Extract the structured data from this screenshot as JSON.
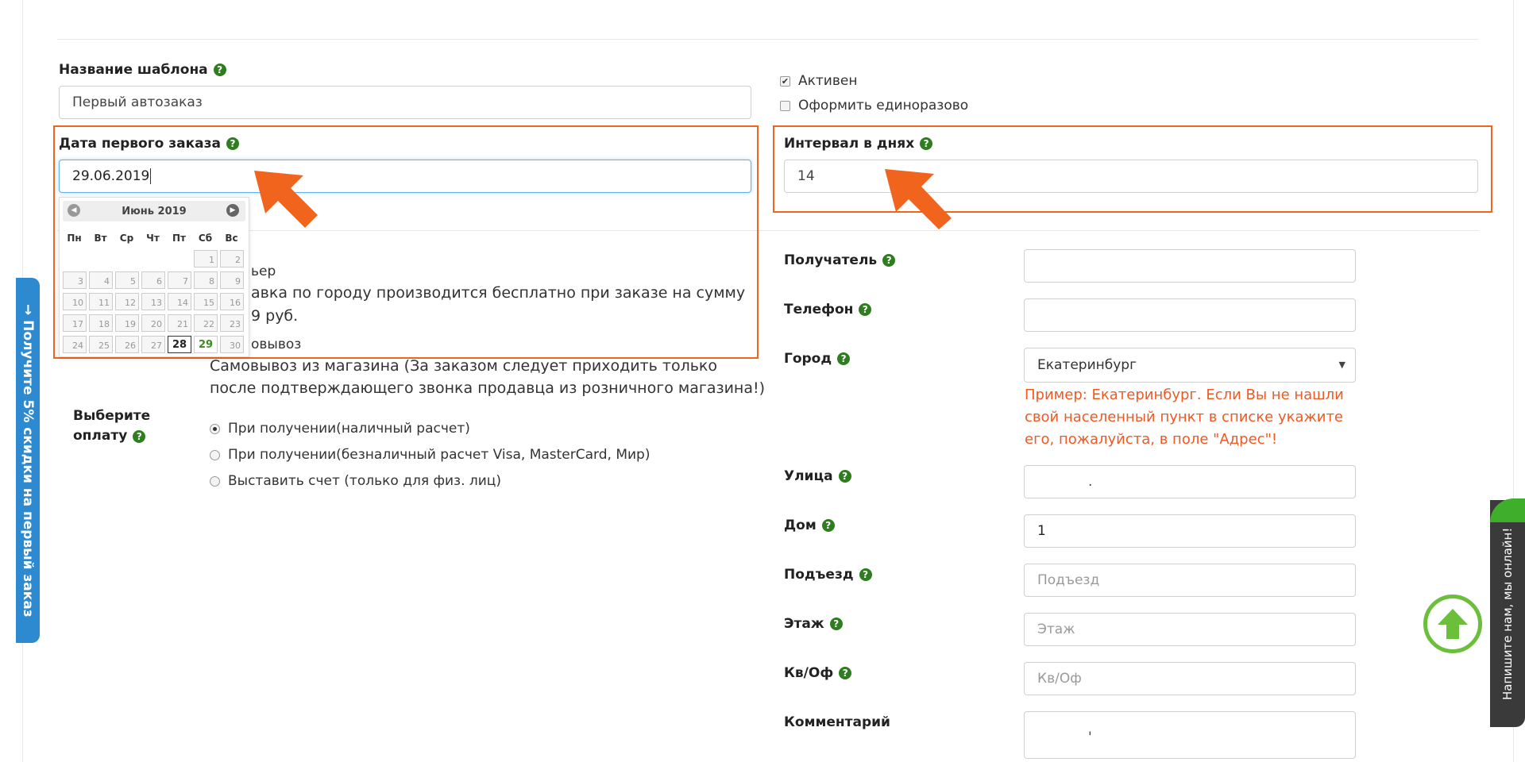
{
  "template": {
    "label": "Название шаблона",
    "value": "Первый автозаказ"
  },
  "active": {
    "label": "Активен",
    "checked": true
  },
  "once": {
    "label": "Оформить единоразово",
    "checked": false
  },
  "first_date": {
    "label": "Дата первого заказа",
    "value": "29.06.2019"
  },
  "interval": {
    "label": "Интервал в днях",
    "value": "14"
  },
  "calendar": {
    "month": "Июнь 2019",
    "weekdays": [
      "Пн",
      "Вт",
      "Ср",
      "Чт",
      "Пт",
      "Сб",
      "Вс"
    ],
    "weeks": [
      [
        "",
        "",
        "",
        "",
        "",
        "1",
        "2"
      ],
      [
        "3",
        "4",
        "5",
        "6",
        "7",
        "8",
        "9"
      ],
      [
        "10",
        "11",
        "12",
        "13",
        "14",
        "15",
        "16"
      ],
      [
        "17",
        "18",
        "19",
        "20",
        "21",
        "22",
        "23"
      ],
      [
        "24",
        "25",
        "26",
        "27",
        "28",
        "29",
        "30"
      ]
    ],
    "today": "28",
    "selected": "29"
  },
  "delivery": {
    "courier_suffix": "ьер",
    "courier_desc_line1": "авка по городу производится бесплатно при заказе на сумму",
    "courier_desc_line2": "9 руб.",
    "pickup_suffix": "овывоз",
    "pickup_desc_line1": "Самовывоз из магазина (За заказом следует приходить только",
    "pickup_desc_line2": "после подтверждающего звонка продавца из розничного магазина!)"
  },
  "payment": {
    "label_line1": "Выберите",
    "label_line2": "оплату",
    "options": [
      {
        "label": "При получении(наличный расчет)",
        "selected": true
      },
      {
        "label": "При получении(безналичный расчет Visa, MasterCard, Мир)",
        "selected": false
      },
      {
        "label": "Выставить счет (только для физ. лиц)",
        "selected": false
      }
    ]
  },
  "recipient": {
    "label": "Получатель",
    "value": ""
  },
  "phone": {
    "label": "Телефон",
    "value": ""
  },
  "city": {
    "label": "Город",
    "value": "Екатеринбург",
    "hint_line1": "Пример: Екатеринбург. Если Вы не нашли",
    "hint_line2": "свой населенный пункт в списке укажите",
    "hint_line3": "его, пожалуйста, в поле \"Адрес\"!"
  },
  "street": {
    "label": "Улица",
    "value": "."
  },
  "house": {
    "label": "Дом",
    "value": "1"
  },
  "entrance": {
    "label": "Подъезд",
    "placeholder": "Подъезд"
  },
  "floor": {
    "label": "Этаж",
    "placeholder": "Этаж"
  },
  "apt": {
    "label": "Кв/Оф",
    "placeholder": "Кв/Оф"
  },
  "comment": {
    "label": "Комментарий",
    "value": "'"
  },
  "promo": {
    "text": "→ Получите  5% скидки на первый заказ"
  },
  "chat": {
    "text": "Напишите нам, мы онлайн!"
  },
  "colors": {
    "accent": "#f0641e",
    "help": "#2e7d1e",
    "promo": "#2d8ad0",
    "scroll_up": "#6bbf3a"
  }
}
